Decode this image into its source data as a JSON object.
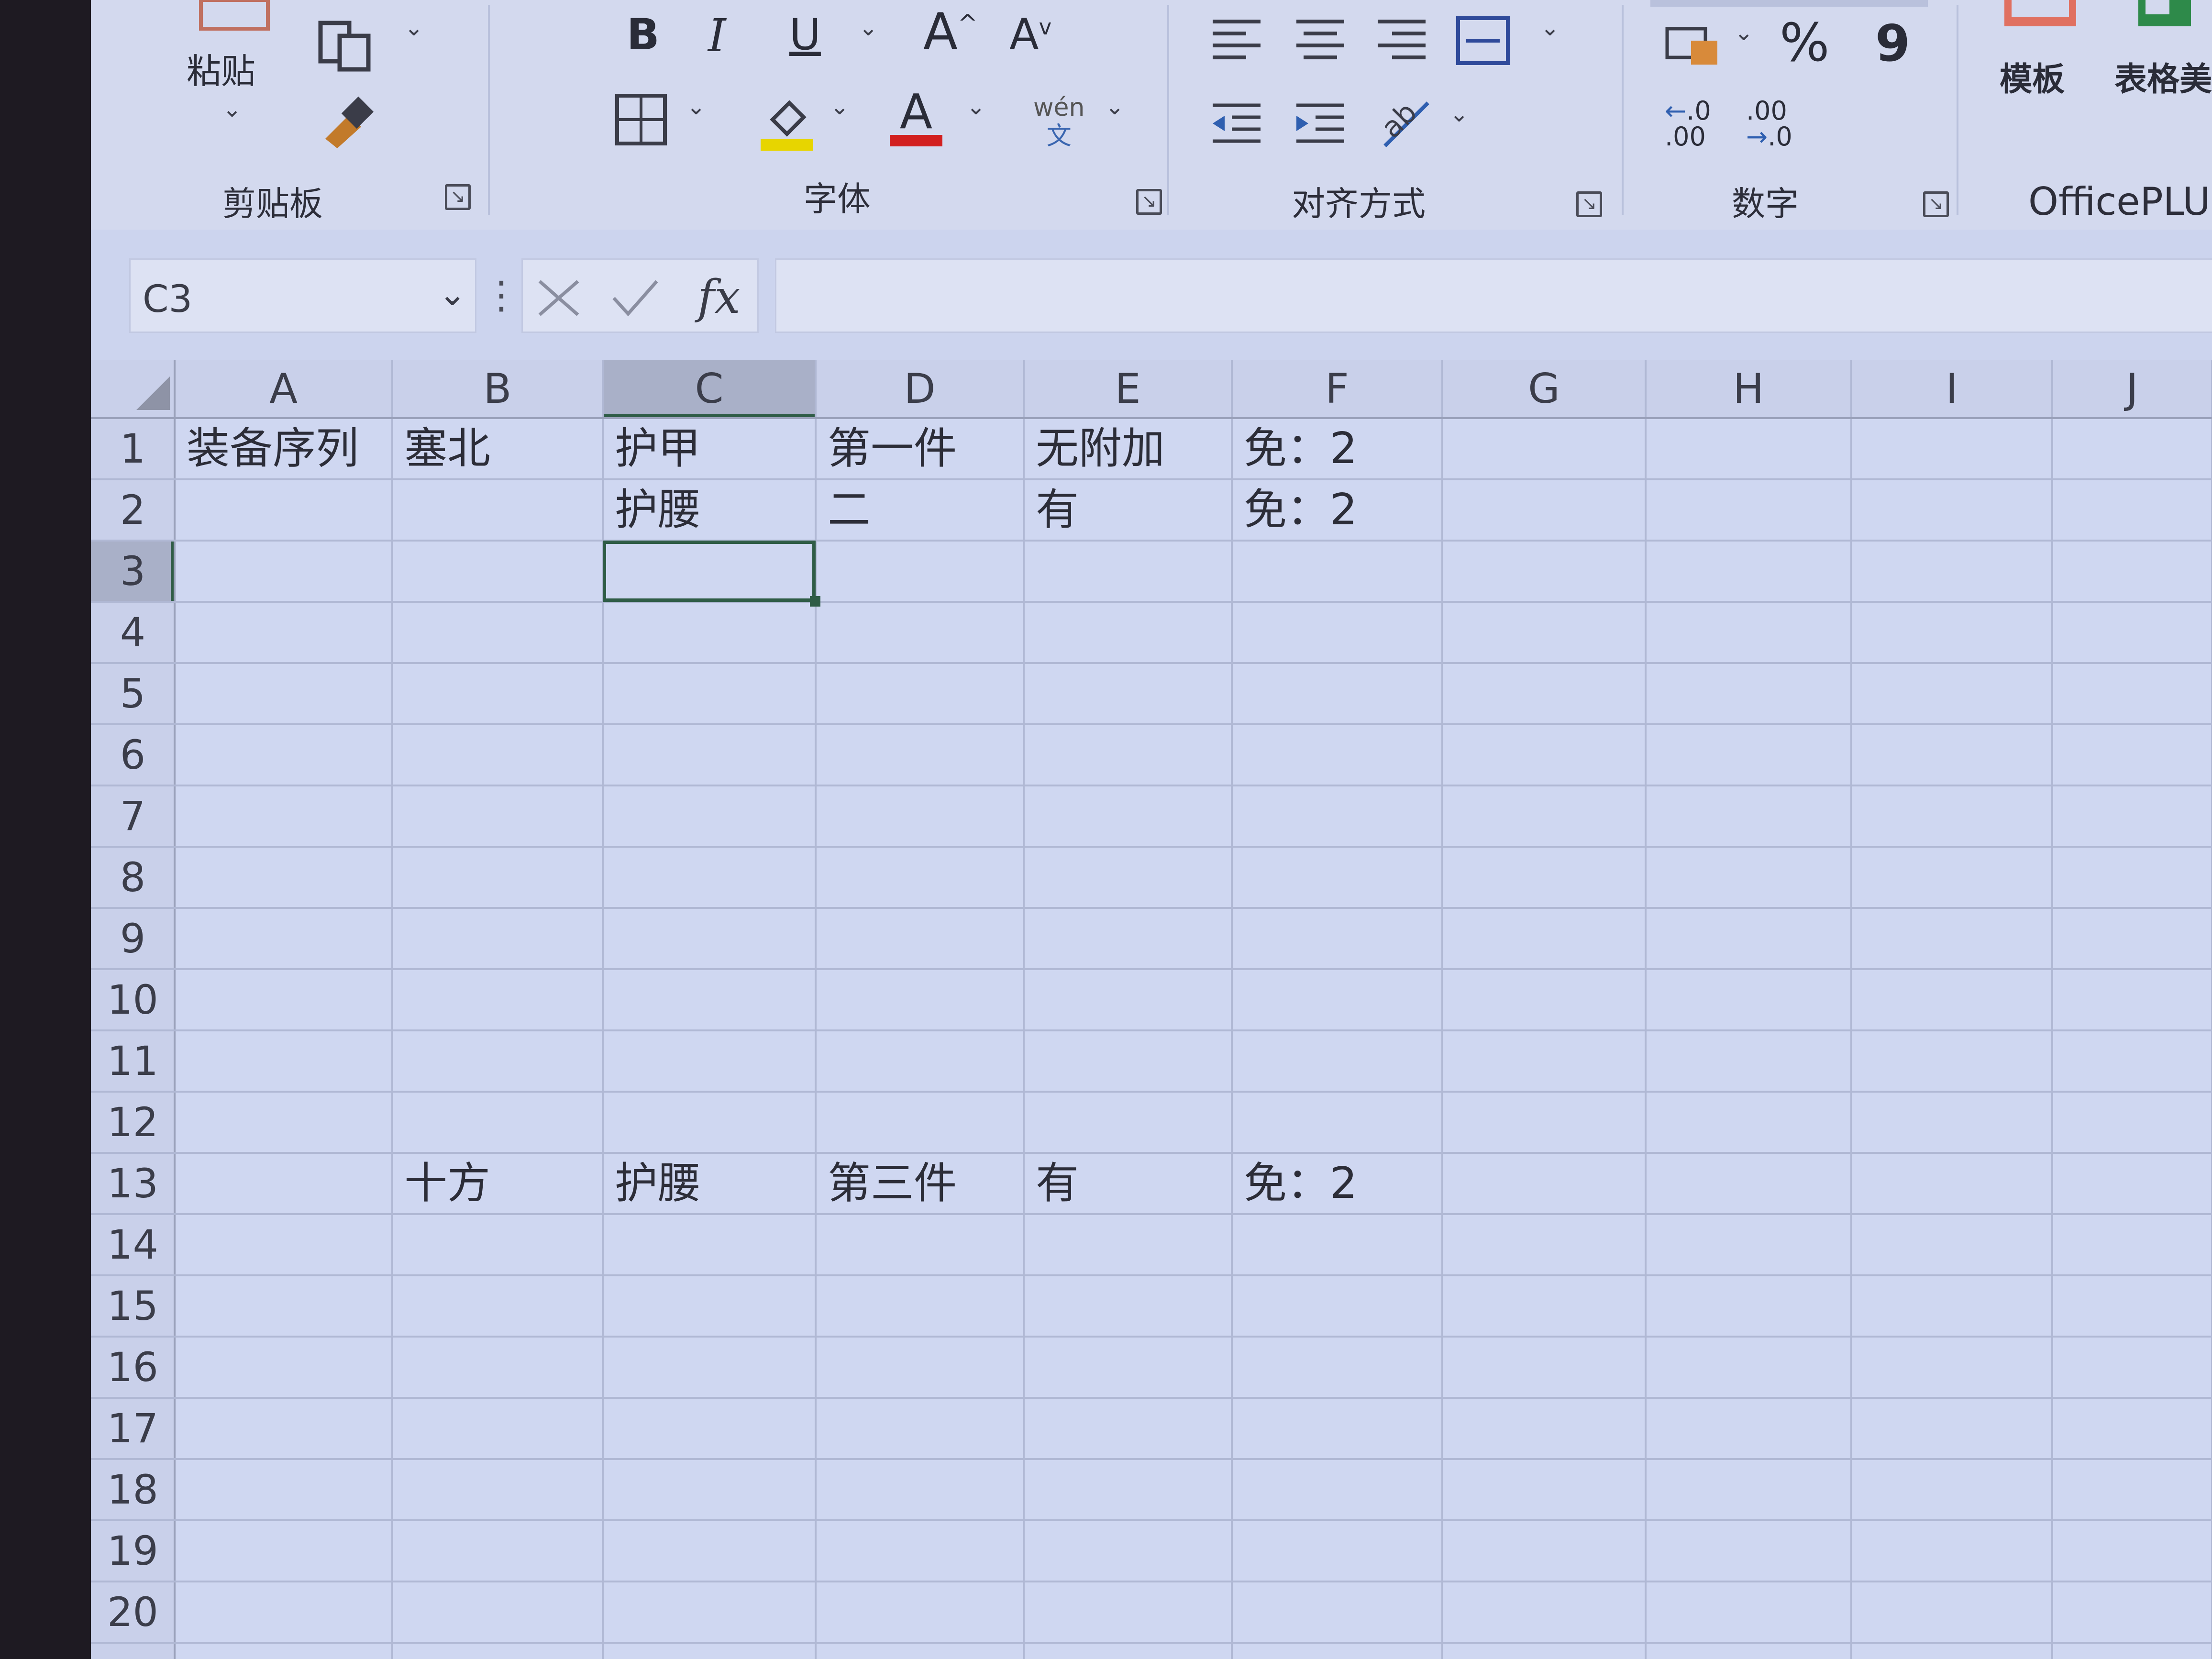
{
  "ribbon": {
    "clipboard": {
      "label": "剪贴板",
      "paste_label": "粘贴",
      "icons": [
        "paste-icon",
        "copy-icon",
        "format-painter-icon"
      ]
    },
    "font": {
      "label": "字体",
      "bold": "B",
      "italic": "I",
      "underline": "U",
      "grow_font": "A",
      "shrink_font": "A",
      "font_color": "A",
      "phonetic_top": "wén",
      "phonetic_bottom": "文",
      "icons": [
        "borders-icon",
        "fill-color-icon",
        "phonetic-guide-icon"
      ],
      "accent_colors": {
        "fill_color": "#e7d500",
        "font_color": "#d21f1f"
      }
    },
    "alignment": {
      "label": "对齐方式",
      "icons": [
        "align-left-icon",
        "align-center-icon",
        "align-right-icon",
        "merge-center-icon",
        "decrease-indent-icon",
        "increase-indent-icon",
        "orientation-icon"
      ]
    },
    "number": {
      "label": "数字",
      "percent": "%",
      "comma": "9",
      "increase_decimal_top": ".0",
      "increase_decimal_bottom": ".00",
      "decrease_decimal_top": ".00",
      "decrease_decimal_bottom": ".0",
      "icons": [
        "accounting-format-icon"
      ]
    },
    "officeplus": {
      "label": "OfficePLUS",
      "templates": "模板",
      "beautify": "表格美化",
      "icons": [
        "templates-icon",
        "table-beautify-icon"
      ]
    }
  },
  "formula_bar": {
    "name_box": "C3",
    "fx": "fx",
    "formula": ""
  },
  "sheet": {
    "columns": [
      "A",
      "B",
      "C",
      "D",
      "E",
      "F",
      "G",
      "H",
      "I",
      "J"
    ],
    "rows": [
      "1",
      "2",
      "3",
      "4",
      "5",
      "6",
      "7",
      "8",
      "9",
      "10",
      "11",
      "12",
      "13",
      "14",
      "15",
      "16",
      "17",
      "18",
      "19",
      "20"
    ],
    "cells": {
      "A1": "装备序列",
      "B1": "塞北",
      "C1": "护甲",
      "D1": "第一件",
      "E1": "无附加",
      "F1": "免：2",
      "C2": "护腰",
      "D2": "二",
      "E2": "有",
      "F2": "免：2",
      "B13": "十方",
      "C13": "护腰",
      "D13": "第三件",
      "E13": "有",
      "F13": "免：2"
    },
    "selected_cell": "C3"
  }
}
